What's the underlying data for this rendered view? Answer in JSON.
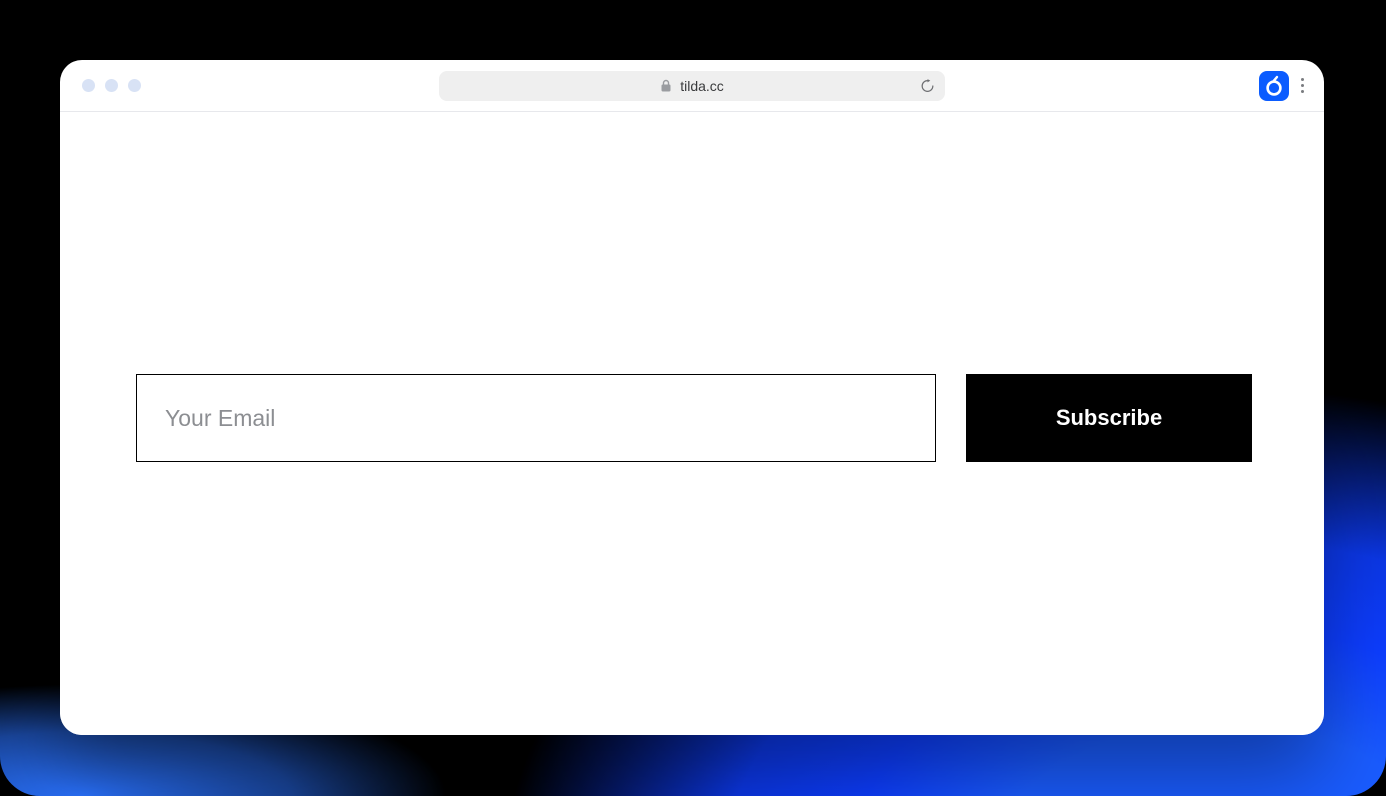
{
  "browser": {
    "url": "tilda.cc"
  },
  "form": {
    "email_placeholder": "Your Email",
    "email_value": "",
    "submit_label": "Subscribe"
  }
}
